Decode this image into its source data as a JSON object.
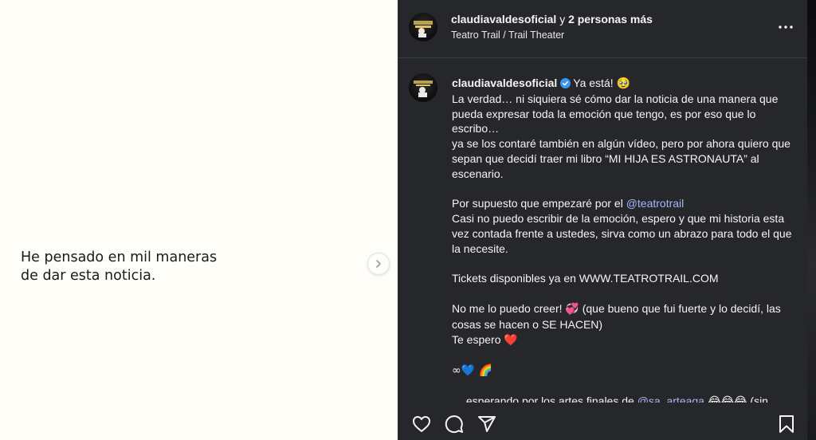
{
  "image": {
    "text_line1": "He pensado en mil maneras",
    "text_line2": "de dar esta noticia.",
    "next_icon": "chevron-right-icon"
  },
  "header": {
    "username": "claudiavaldesoficial",
    "conjunction": "y",
    "others": "2 personas más",
    "location": "Teatro Trail / Trail Theater",
    "more_icon": "more-horizontal-icon"
  },
  "caption": {
    "username": "claudiavaldesoficial",
    "verified_color": "#3897f0",
    "p1_start": "Ya está! ",
    "p1_emoji": "🥹",
    "p1_rest": "La verdad… ni siquiera sé cómo dar la noticia de una manera que pueda expresar toda la emoción que tengo, es por eso que lo escribo…\nya se los contaré también en algún vídeo, pero por ahora quiero que sepan que decidí traer mi libro “MI HIJA ES ASTRONAUTA” al escenario.",
    "p2_start": "Por supuesto que empezaré por el ",
    "p2_mention": "@teatrotrail",
    "p2_rest": "Casi no puedo escribir de la emoción, espero y que mi historia esta vez contada frente a ustedes, sirva como un abrazo para todo el que la necesite.",
    "p3": "Tickets disponibles ya en WWW.TEATROTRAIL.COM",
    "p4_start": "No me lo puedo creer! ",
    "p4_emoji": "💞",
    "p4_rest": " (que bueno que fui fuerte y lo decidí, las cosas se hacen o SE HACEN)",
    "p4_end": "Te espero ",
    "p4_heart": "❤️",
    "p5_symbols": "∞💙 🌈",
    "p6_start": "… esperando por los artes finales de ",
    "p6_mention": "@sa_arteaga",
    "p6_emojis": " 😂😂😂",
    "p6_rest": " (sin"
  },
  "actions": {
    "like_icon": "heart-icon",
    "comment_icon": "comment-icon",
    "share_icon": "share-icon",
    "save_icon": "bookmark-icon"
  },
  "colors": {
    "post_bg": "#26272b",
    "image_bg": "#fefdf8",
    "mention": "#a7b7f5"
  }
}
